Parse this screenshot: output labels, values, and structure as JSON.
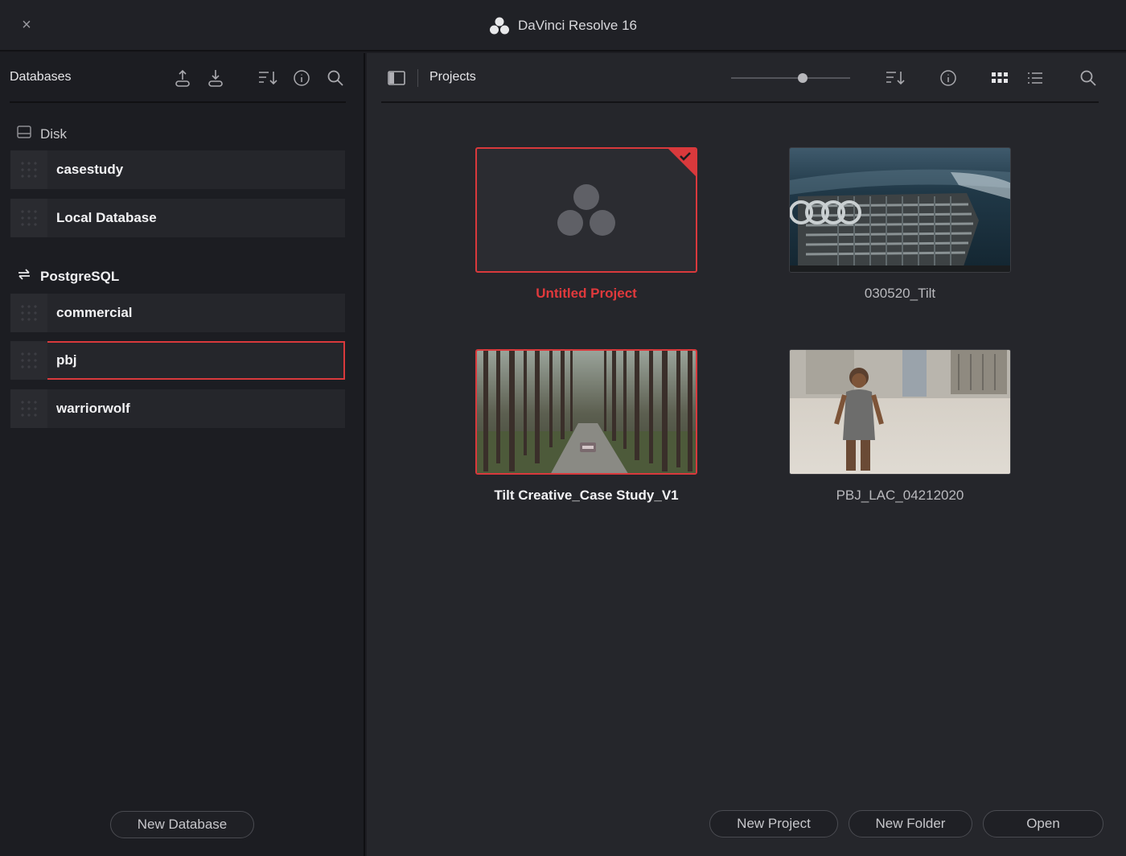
{
  "window": {
    "title": "DaVinci Resolve 16",
    "close_glyph": "×"
  },
  "databases": {
    "panel_title": "Databases",
    "toolbar_icons": [
      "upload-icon",
      "download-icon",
      "sort-icon",
      "info-icon",
      "search-icon"
    ],
    "disk_section": {
      "label": "Disk",
      "icon": "drive-icon",
      "items": [
        {
          "label": "casestudy",
          "selected": false
        },
        {
          "label": "Local Database",
          "selected": false
        }
      ]
    },
    "postgres_section": {
      "label": "PostgreSQL",
      "icon": "network-arrows-icon",
      "items": [
        {
          "label": "commercial",
          "selected": false
        },
        {
          "label": "pbj",
          "selected": true
        },
        {
          "label": "warriorwolf",
          "selected": false
        }
      ]
    },
    "new_button": "New Database"
  },
  "projects": {
    "panel_title": "Projects",
    "toolbar_icons": [
      "sidebar-toggle-icon",
      "sort-icon",
      "info-icon",
      "grid-view-icon",
      "list-view-icon",
      "search-icon"
    ],
    "zoom_level": 0.6,
    "items": [
      {
        "name": "Untitled Project",
        "thumbnail": "davinci-logo-placeholder",
        "state": "current"
      },
      {
        "name": "030520_Tilt",
        "thumbnail": "car-grille-photo",
        "state": "normal"
      },
      {
        "name": "Tilt Creative_Case Study_V1",
        "thumbnail": "forest-road-photo",
        "state": "selected"
      },
      {
        "name": "PBJ_LAC_04212020",
        "thumbnail": "child-street-photo",
        "state": "normal"
      }
    ],
    "buttons": {
      "new_project": "New Project",
      "new_folder": "New Folder",
      "open": "Open"
    }
  },
  "colors": {
    "accent_red": "#d9393c",
    "panel_dark": "#1c1d22",
    "panel_light": "#25262b"
  }
}
